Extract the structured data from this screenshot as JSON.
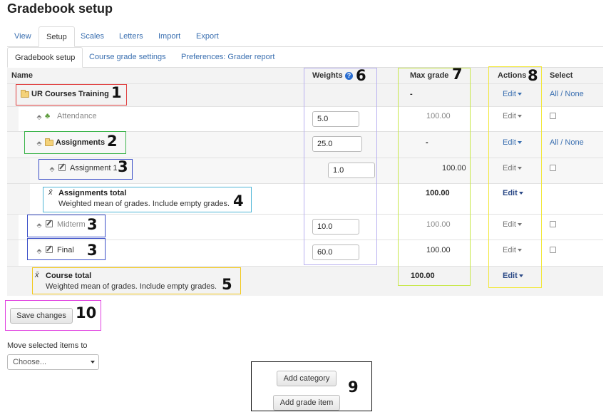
{
  "page": {
    "title": "Gradebook setup"
  },
  "tabs": [
    {
      "label": "View",
      "active": false
    },
    {
      "label": "Setup",
      "active": true
    },
    {
      "label": "Scales",
      "active": false
    },
    {
      "label": "Letters",
      "active": false
    },
    {
      "label": "Import",
      "active": false
    },
    {
      "label": "Export",
      "active": false
    }
  ],
  "subtabs": [
    {
      "label": "Gradebook setup",
      "active": true
    },
    {
      "label": "Course grade settings",
      "active": false
    },
    {
      "label": "Preferences: Grader report",
      "active": false
    }
  ],
  "table": {
    "headers": {
      "name": "Name",
      "weights": "Weights",
      "max": "Max grade",
      "actions": "Actions",
      "select": "Select"
    },
    "rows": [
      {
        "name": "UR Courses Training",
        "max": "-",
        "edit": "Edit",
        "select": "All / None"
      },
      {
        "name": "Attendance",
        "weight": "5.0",
        "max": "100.00",
        "edit": "Edit"
      },
      {
        "name": "Assignments",
        "weight": "25.0",
        "max": "-",
        "edit": "Edit",
        "select": "All / None"
      },
      {
        "name": "Assignment 1",
        "weight": "1.0",
        "max": "100.00",
        "edit": "Edit"
      },
      {
        "name": "Assignments total",
        "desc": "Weighted mean of grades. Include empty grades.",
        "max": "100.00",
        "edit": "Edit"
      },
      {
        "name": "Midterm",
        "weight": "10.0",
        "max": "100.00",
        "edit": "Edit"
      },
      {
        "name": "Final",
        "weight": "60.0",
        "max": "100.00",
        "edit": "Edit"
      },
      {
        "name": "Course total",
        "desc": "Weighted mean of grades. Include empty grades.",
        "max": "100.00",
        "edit": "Edit"
      }
    ]
  },
  "annotations": [
    "1",
    "2",
    "3",
    "3",
    "4",
    "3",
    "3",
    "5",
    "6",
    "7",
    "8",
    "9",
    "10"
  ],
  "buttons": {
    "save": "Save changes",
    "add_category": "Add category",
    "add_grade_item": "Add grade item"
  },
  "move": {
    "label": "Move selected items to",
    "choose": "Choose..."
  },
  "colors": {
    "link": "#3a6fb0",
    "ann1": "#e04040",
    "ann2": "#3cb44b",
    "ann3": "#3b4fc8",
    "ann4": "#4fb5d6",
    "ann5": "#f2c81c",
    "ann6": "#b8b0f0",
    "ann7": "#c8e84a",
    "ann8": "#f2e83a",
    "ann9": "#111111",
    "ann10": "#e040e0"
  }
}
